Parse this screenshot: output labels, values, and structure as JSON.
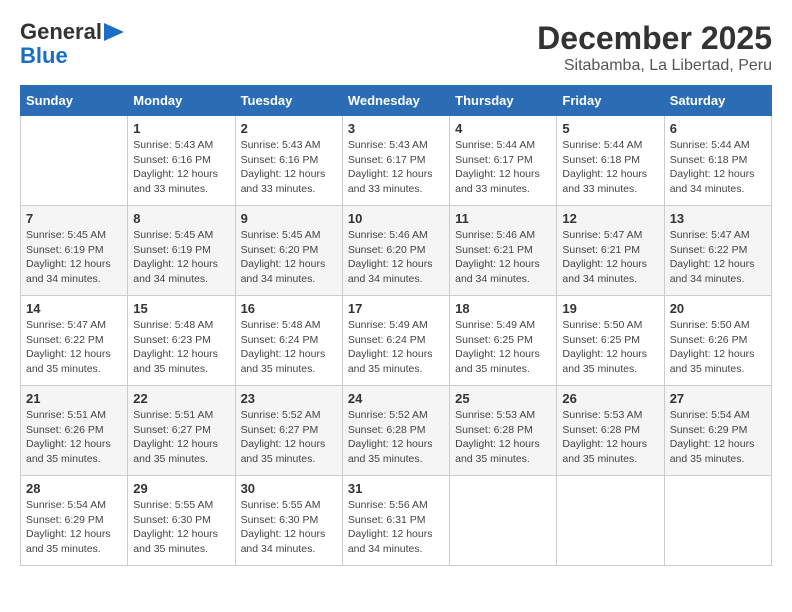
{
  "header": {
    "logo": {
      "general": "General",
      "blue": "Blue",
      "triangle": "▶"
    },
    "title": "December 2025",
    "location": "Sitabamba, La Libertad, Peru"
  },
  "calendar": {
    "days_of_week": [
      "Sunday",
      "Monday",
      "Tuesday",
      "Wednesday",
      "Thursday",
      "Friday",
      "Saturday"
    ],
    "weeks": [
      [
        {
          "day": "",
          "info": ""
        },
        {
          "day": "1",
          "info": "Sunrise: 5:43 AM\nSunset: 6:16 PM\nDaylight: 12 hours\nand 33 minutes."
        },
        {
          "day": "2",
          "info": "Sunrise: 5:43 AM\nSunset: 6:16 PM\nDaylight: 12 hours\nand 33 minutes."
        },
        {
          "day": "3",
          "info": "Sunrise: 5:43 AM\nSunset: 6:17 PM\nDaylight: 12 hours\nand 33 minutes."
        },
        {
          "day": "4",
          "info": "Sunrise: 5:44 AM\nSunset: 6:17 PM\nDaylight: 12 hours\nand 33 minutes."
        },
        {
          "day": "5",
          "info": "Sunrise: 5:44 AM\nSunset: 6:18 PM\nDaylight: 12 hours\nand 33 minutes."
        },
        {
          "day": "6",
          "info": "Sunrise: 5:44 AM\nSunset: 6:18 PM\nDaylight: 12 hours\nand 34 minutes."
        }
      ],
      [
        {
          "day": "7",
          "info": "Sunrise: 5:45 AM\nSunset: 6:19 PM\nDaylight: 12 hours\nand 34 minutes."
        },
        {
          "day": "8",
          "info": "Sunrise: 5:45 AM\nSunset: 6:19 PM\nDaylight: 12 hours\nand 34 minutes."
        },
        {
          "day": "9",
          "info": "Sunrise: 5:45 AM\nSunset: 6:20 PM\nDaylight: 12 hours\nand 34 minutes."
        },
        {
          "day": "10",
          "info": "Sunrise: 5:46 AM\nSunset: 6:20 PM\nDaylight: 12 hours\nand 34 minutes."
        },
        {
          "day": "11",
          "info": "Sunrise: 5:46 AM\nSunset: 6:21 PM\nDaylight: 12 hours\nand 34 minutes."
        },
        {
          "day": "12",
          "info": "Sunrise: 5:47 AM\nSunset: 6:21 PM\nDaylight: 12 hours\nand 34 minutes."
        },
        {
          "day": "13",
          "info": "Sunrise: 5:47 AM\nSunset: 6:22 PM\nDaylight: 12 hours\nand 34 minutes."
        }
      ],
      [
        {
          "day": "14",
          "info": "Sunrise: 5:47 AM\nSunset: 6:22 PM\nDaylight: 12 hours\nand 35 minutes."
        },
        {
          "day": "15",
          "info": "Sunrise: 5:48 AM\nSunset: 6:23 PM\nDaylight: 12 hours\nand 35 minutes."
        },
        {
          "day": "16",
          "info": "Sunrise: 5:48 AM\nSunset: 6:24 PM\nDaylight: 12 hours\nand 35 minutes."
        },
        {
          "day": "17",
          "info": "Sunrise: 5:49 AM\nSunset: 6:24 PM\nDaylight: 12 hours\nand 35 minutes."
        },
        {
          "day": "18",
          "info": "Sunrise: 5:49 AM\nSunset: 6:25 PM\nDaylight: 12 hours\nand 35 minutes."
        },
        {
          "day": "19",
          "info": "Sunrise: 5:50 AM\nSunset: 6:25 PM\nDaylight: 12 hours\nand 35 minutes."
        },
        {
          "day": "20",
          "info": "Sunrise: 5:50 AM\nSunset: 6:26 PM\nDaylight: 12 hours\nand 35 minutes."
        }
      ],
      [
        {
          "day": "21",
          "info": "Sunrise: 5:51 AM\nSunset: 6:26 PM\nDaylight: 12 hours\nand 35 minutes."
        },
        {
          "day": "22",
          "info": "Sunrise: 5:51 AM\nSunset: 6:27 PM\nDaylight: 12 hours\nand 35 minutes."
        },
        {
          "day": "23",
          "info": "Sunrise: 5:52 AM\nSunset: 6:27 PM\nDaylight: 12 hours\nand 35 minutes."
        },
        {
          "day": "24",
          "info": "Sunrise: 5:52 AM\nSunset: 6:28 PM\nDaylight: 12 hours\nand 35 minutes."
        },
        {
          "day": "25",
          "info": "Sunrise: 5:53 AM\nSunset: 6:28 PM\nDaylight: 12 hours\nand 35 minutes."
        },
        {
          "day": "26",
          "info": "Sunrise: 5:53 AM\nSunset: 6:28 PM\nDaylight: 12 hours\nand 35 minutes."
        },
        {
          "day": "27",
          "info": "Sunrise: 5:54 AM\nSunset: 6:29 PM\nDaylight: 12 hours\nand 35 minutes."
        }
      ],
      [
        {
          "day": "28",
          "info": "Sunrise: 5:54 AM\nSunset: 6:29 PM\nDaylight: 12 hours\nand 35 minutes."
        },
        {
          "day": "29",
          "info": "Sunrise: 5:55 AM\nSunset: 6:30 PM\nDaylight: 12 hours\nand 35 minutes."
        },
        {
          "day": "30",
          "info": "Sunrise: 5:55 AM\nSunset: 6:30 PM\nDaylight: 12 hours\nand 34 minutes."
        },
        {
          "day": "31",
          "info": "Sunrise: 5:56 AM\nSunset: 6:31 PM\nDaylight: 12 hours\nand 34 minutes."
        },
        {
          "day": "",
          "info": ""
        },
        {
          "day": "",
          "info": ""
        },
        {
          "day": "",
          "info": ""
        }
      ]
    ]
  }
}
